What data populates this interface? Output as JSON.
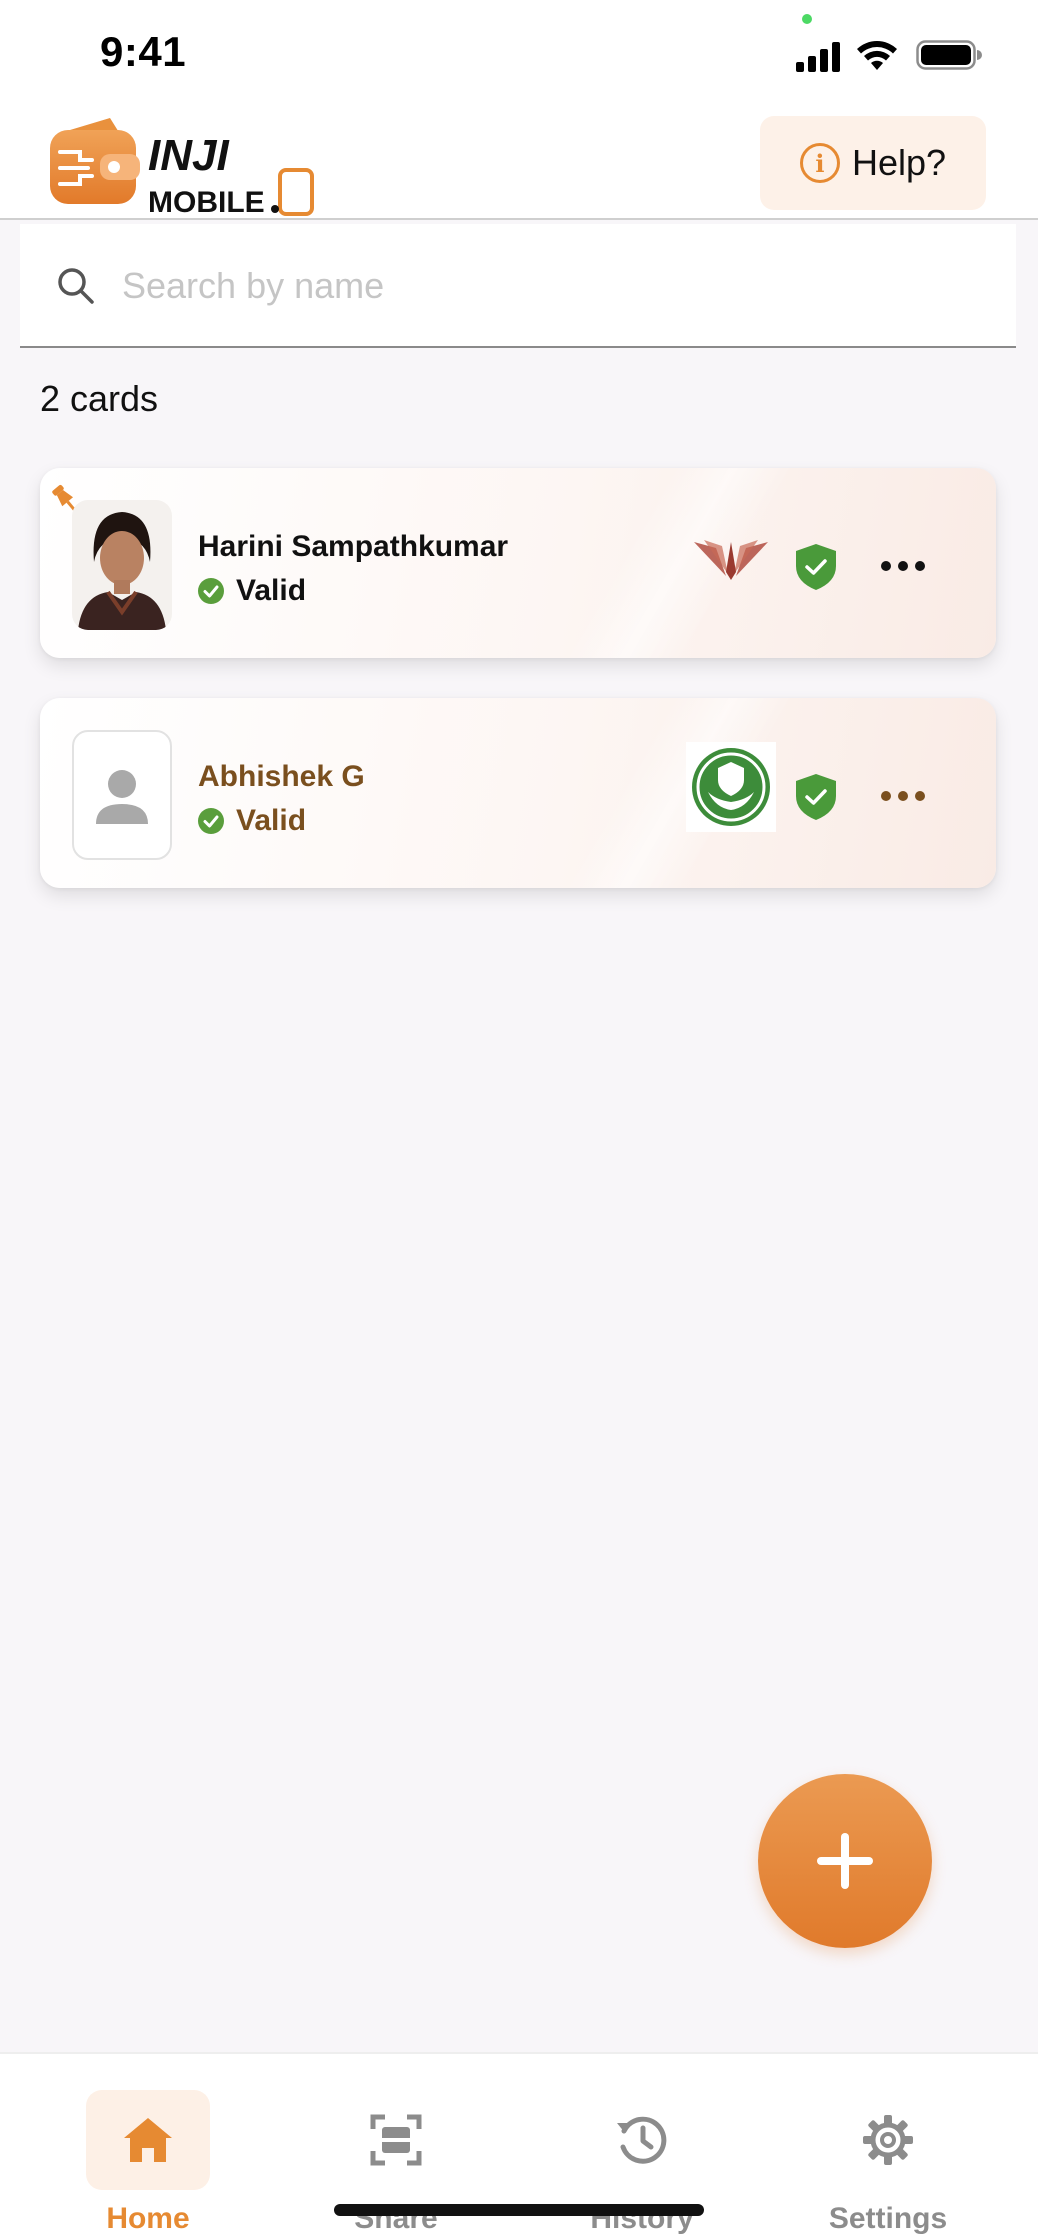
{
  "status_bar": {
    "time": "9:41"
  },
  "header": {
    "logo_text": "INJI MOBILE.",
    "help_label": "Help?"
  },
  "search": {
    "placeholder": "Search by name",
    "value": ""
  },
  "card_count": "2 cards",
  "cards": [
    {
      "name": "Harini Sampathkumar",
      "status": "Valid",
      "pinned": true,
      "text_color": "#111111",
      "issuer": "wings-logo",
      "has_photo": true
    },
    {
      "name": "Abhishek G",
      "status": "Valid",
      "pinned": false,
      "text_color": "#7a4f1e",
      "issuer": "green-hands-logo",
      "has_photo": false
    }
  ],
  "nav": [
    {
      "label": "Home",
      "icon": "home-icon",
      "active": true
    },
    {
      "label": "Share",
      "icon": "scan-icon",
      "active": false
    },
    {
      "label": "History",
      "icon": "history-icon",
      "active": false
    },
    {
      "label": "Settings",
      "icon": "gear-icon",
      "active": false
    }
  ],
  "colors": {
    "accent": "#e68a32",
    "valid": "#5a9e3c",
    "background": "#f8f6f9"
  }
}
